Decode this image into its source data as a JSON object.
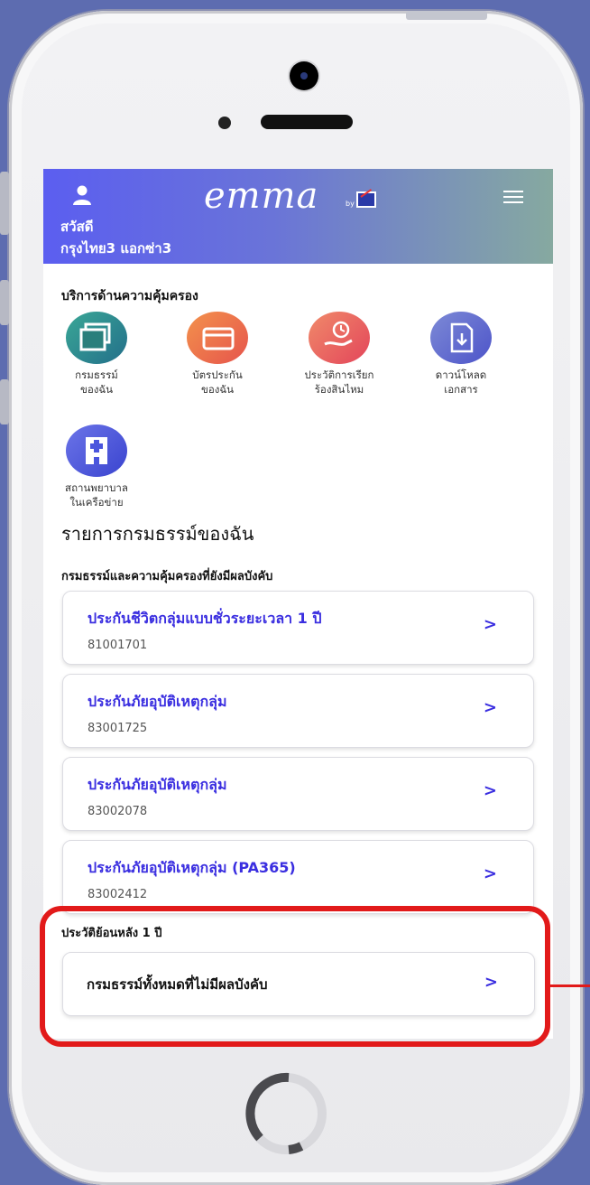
{
  "header": {
    "logo_text": "emma",
    "logo_by": "by",
    "greeting": "สวัสดี",
    "user_name": "กรุงไทย3 แอกซ่า3"
  },
  "services": {
    "title": "บริการด้านความคุ้มครอง",
    "items": [
      {
        "line1": "กรมธรรม์",
        "line2": "ของฉัน",
        "icon": "policy-document-icon",
        "color": "#2f8f7f"
      },
      {
        "line1": "บัตรประกัน",
        "line2": "ของฉัน",
        "icon": "insurance-card-icon",
        "color": "#ec6a4a"
      },
      {
        "line1": "ประวัติการเรียก",
        "line2": "ร้องสินไหม",
        "icon": "claim-history-icon",
        "color": "#e4585a"
      },
      {
        "line1": "ดาวน์โหลด",
        "line2": "เอกสาร",
        "icon": "download-document-icon",
        "color": "#5b5fcf"
      },
      {
        "line1": "สถานพยาบาล",
        "line2": "ในเครือข่าย",
        "icon": "hospital-icon",
        "color": "#4a55dd"
      }
    ]
  },
  "policies": {
    "title": "รายการกรมธรรม์ของฉัน",
    "active_title": "กรมธรรม์และความคุ้มครองที่ยังมีผลบังคับ",
    "items": [
      {
        "name": "ประกันชีวิตกลุ่มแบบชั่วระยะเวลา 1 ปี",
        "number": "81001701"
      },
      {
        "name": "ประกันภัยอุบัติเหตุกลุ่ม",
        "number": "83001725"
      },
      {
        "name": "ประกันภัยอุบัติเหตุกลุ่ม",
        "number": "83002078"
      },
      {
        "name": "ประกันภัยอุบัติเหตุกลุ่ม (PA365)",
        "number": "83002412"
      }
    ],
    "chevron": ">"
  },
  "history": {
    "title": "ประวัติย้อนหลัง 1 ปี",
    "inactive_label": "กรมธรรม์ทั้งหมดที่ไม่มีผลบังคับ"
  },
  "colors": {
    "accent": "#3a2ee0",
    "highlight": "#e21a1a"
  }
}
